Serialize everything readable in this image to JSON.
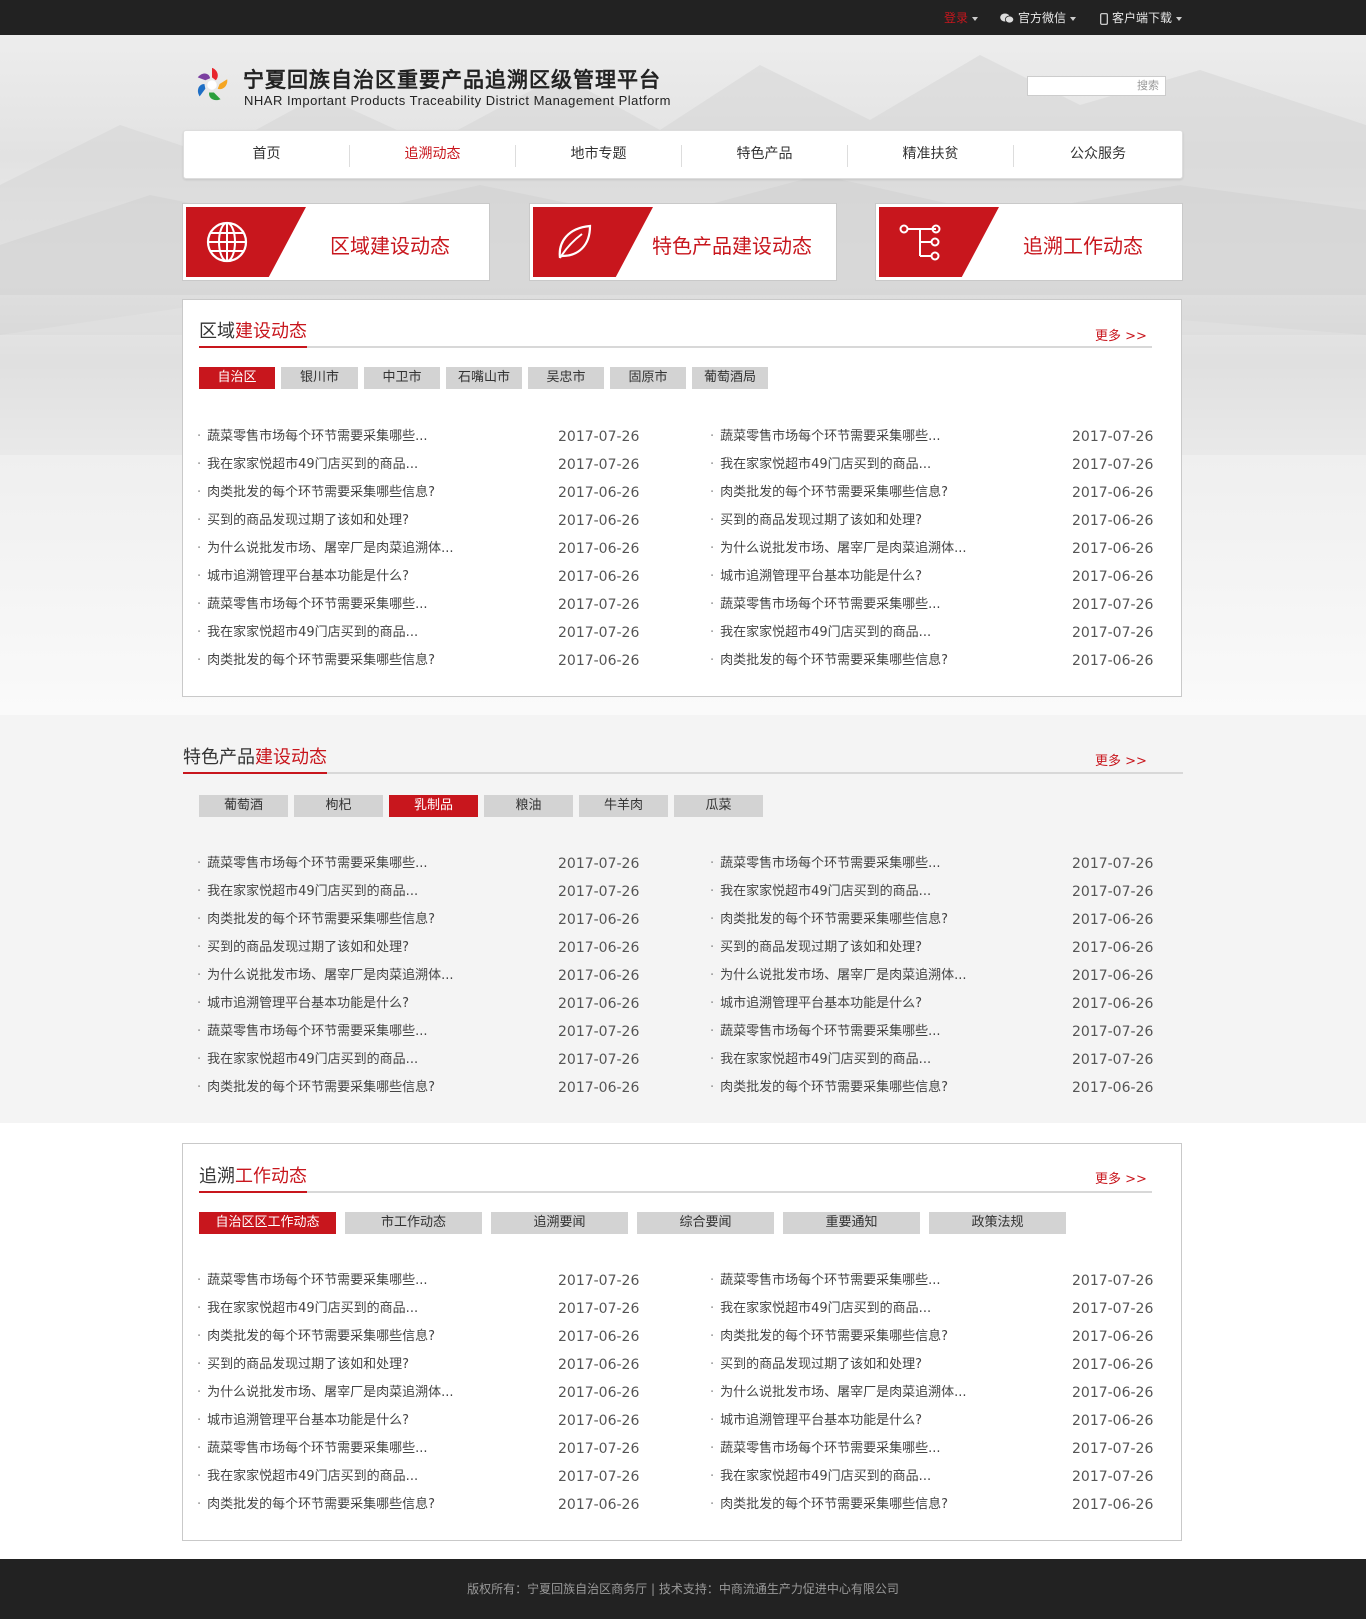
{
  "topbar": {
    "login": "登录",
    "wechat": "官方微信",
    "download": "客户端下载"
  },
  "header": {
    "title": "宁夏回族自治区重要产品追溯区级管理平台",
    "subtitle": "NHAR Important Products Traceability District Management Platform",
    "search_placeholder": "搜索"
  },
  "nav": [
    "首页",
    "追溯动态",
    "地市专题",
    "特色产品",
    "精准扶贫",
    "公众服务"
  ],
  "cards": [
    "区域建设动态",
    "特色产品建设动态",
    "追溯工作动态"
  ],
  "more_label": "更多 >>",
  "sections": [
    {
      "title_plain": "区域",
      "title_highlight": "建设动态",
      "tabs": [
        "自治区",
        "银川市",
        "中卫市",
        "石嘴山市",
        "吴忠市",
        "固原市",
        "葡萄酒局"
      ],
      "active_tab": 0
    },
    {
      "title_plain": "特色产品",
      "title_highlight": "建设动态",
      "tabs": [
        "葡萄酒",
        "枸杞",
        "乳制品",
        "粮油",
        "牛羊肉",
        "瓜菜"
      ],
      "active_tab": 2
    },
    {
      "title_plain": "追溯",
      "title_highlight": "工作动态",
      "tabs": [
        "自治区区工作动态",
        "市工作动态",
        "追溯要闻",
        "综合要闻",
        "重要通知",
        "政策法规"
      ],
      "active_tab": 0
    }
  ],
  "articles": [
    {
      "title": "蔬菜零售市场每个环节需要采集哪些...",
      "date": "2017-07-26"
    },
    {
      "title": "我在家家悦超市49门店买到的商品...",
      "date": "2017-07-26"
    },
    {
      "title": "肉类批发的每个环节需要采集哪些信息?",
      "date": "2017-06-26"
    },
    {
      "title": "买到的商品发现过期了该如和处理?",
      "date": "2017-06-26"
    },
    {
      "title": "为什么说批发市场、屠宰厂是肉菜追溯体...",
      "date": "2017-06-26"
    },
    {
      "title": "城市追溯管理平台基本功能是什么?",
      "date": "2017-06-26"
    },
    {
      "title": "蔬菜零售市场每个环节需要采集哪些...",
      "date": "2017-07-26"
    },
    {
      "title": "我在家家悦超市49门店买到的商品...",
      "date": "2017-07-26"
    },
    {
      "title": "肉类批发的每个环节需要采集哪些信息?",
      "date": "2017-06-26"
    }
  ],
  "footer": "版权所有：宁夏回族自治区商务厅 | 技术支持：中商流通生产力促进中心有限公司",
  "colors": {
    "accent": "#c8161d",
    "topbar": "#222222",
    "tab_inactive": "#d3d3d3"
  }
}
